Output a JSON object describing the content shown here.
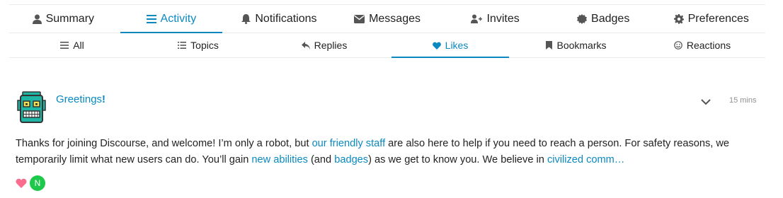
{
  "main_nav": [
    {
      "label": "Summary",
      "icon": "user-icon"
    },
    {
      "label": "Activity",
      "icon": "list-icon",
      "active": true
    },
    {
      "label": "Notifications",
      "icon": "bell-icon"
    },
    {
      "label": "Messages",
      "icon": "envelope-icon"
    },
    {
      "label": "Invites",
      "icon": "user-plus-icon"
    },
    {
      "label": "Badges",
      "icon": "certificate-icon"
    },
    {
      "label": "Preferences",
      "icon": "gear-icon"
    }
  ],
  "sub_nav": [
    {
      "label": "All",
      "icon": "list-icon"
    },
    {
      "label": "Topics",
      "icon": "list-ul-icon"
    },
    {
      "label": "Replies",
      "icon": "reply-icon"
    },
    {
      "label": "Likes",
      "icon": "heart-icon",
      "active": true
    },
    {
      "label": "Bookmarks",
      "icon": "bookmark-icon"
    },
    {
      "label": "Reactions",
      "icon": "smile-icon"
    }
  ],
  "post": {
    "title": "Greetings",
    "title_suffix": "!",
    "time": "15 mins",
    "excerpt": {
      "t1": "Thanks for joining Discourse, and welcome! I’m only a robot, but ",
      "l1": "our friendly staff",
      "t2": " are also here to help if you need to reach a person. For safety reasons, we temporarily limit what new users can do. You’ll gain ",
      "l2": "new abilities",
      "t3": " (and ",
      "l3": "badges",
      "t4": ") as we get to know you. We believe in ",
      "l4": "civilized comm…"
    },
    "like_avatar_letter": "N"
  },
  "colors": {
    "accent": "#0a89c1",
    "heart": "#fa6c8d",
    "avatar_bg": "#1ec84a",
    "robot_teal": "#1fb5a5"
  }
}
